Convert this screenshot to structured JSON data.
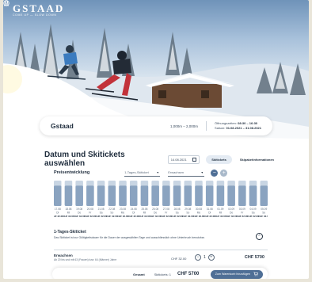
{
  "header": {
    "logo_name": "GSTAAD",
    "logo_tagline": "COME UP — SLOW DOWN",
    "icons": [
      "globe-icon",
      "user-icon"
    ]
  },
  "destination": {
    "name": "Gstaad",
    "altitude": "1,000m – 2,000m",
    "hours_label": "Öffnungszeiten:",
    "hours_value": "08:30 – 16:30",
    "season_label": "Saison:",
    "season_value": "01.08.2021 – 31.08.2021"
  },
  "selection": {
    "heading": "Datum und Skitickets auswählen",
    "date_value": "14.08.2021",
    "tickets_button": "Skitickets",
    "link_label": "Skipaketinformationen"
  },
  "chart_controls": {
    "title": "Preisentwicklung",
    "ticket_select": "1-Tages-Skiticket",
    "person_select": "Erwachsen",
    "zoom_out": "−",
    "zoom_in": "+"
  },
  "chart_data": {
    "type": "bar",
    "categories": [
      "17.08",
      "18.08",
      "19.08",
      "20.08",
      "21.08",
      "22.08",
      "23.08",
      "24.08",
      "25.08",
      "26.08",
      "27.08",
      "28.08",
      "29.08",
      "30.08",
      "31.08",
      "01.09",
      "02.09",
      "03.09",
      "04.09",
      "05.09"
    ],
    "weekdays": [
      "Di",
      "Mi",
      "Do",
      "Fr",
      "Sa",
      "So",
      "Mo",
      "Di",
      "Mi",
      "Do",
      "Fr",
      "Sa",
      "So",
      "Mo",
      "Di",
      "Mi",
      "Do",
      "Fr",
      "Sa",
      "So"
    ],
    "price_labels": [
      "CHF 32.00",
      "CHF 32.00",
      "CHF 32.00",
      "CHF 32.00",
      "CHF 32.00",
      "CHF 32.00",
      "CHF 32.00",
      "CHF 32.00",
      "CHF 32.00",
      "CHF 32.00",
      "CHF 32.00",
      "CHF 32.00",
      "CHF 32.00",
      "CHF 32.00",
      "CHF 32.00",
      "CHF 32.00",
      "CHF 32.00",
      "CHF 32.00",
      "CHF 32.00",
      "CHF 32.00"
    ],
    "values": [
      32,
      32,
      32,
      32,
      32,
      32,
      32,
      32,
      32,
      32,
      32,
      32,
      32,
      32,
      32,
      32,
      32,
      32,
      32,
      32
    ],
    "ylim": [
      0,
      40
    ],
    "grid": false,
    "colors": {
      "bar_fill": "#8aa3c0",
      "bar_bg": "#c8d5e3"
    }
  },
  "ticket_panel": {
    "title": "1-Tages-Skiticket",
    "description": "Das Skiticket ist zur Gültigkeitsdauer für die Dauer der ausgewählten Tage und ausschliesslich ohne Unterbruch benutzbar.",
    "rows": [
      {
        "label": "Erwachsen",
        "sub": "Ab 20 bis und mit 63 (Frauen) bzw. 64 (Männer) Jahre",
        "price": "CHF 32.00",
        "qty": "1",
        "total": "CHF 5700"
      }
    ]
  },
  "footer": {
    "total_label": "Gesamt",
    "count_label": "Skitickets: 1",
    "total_value": "CHF 5700",
    "cart_button": "Zum Warenkorb hinzufügen"
  },
  "colors": {
    "accent": "#4f6f96",
    "text": "#1f2d3d",
    "page_bg": "#e9e5d9"
  }
}
